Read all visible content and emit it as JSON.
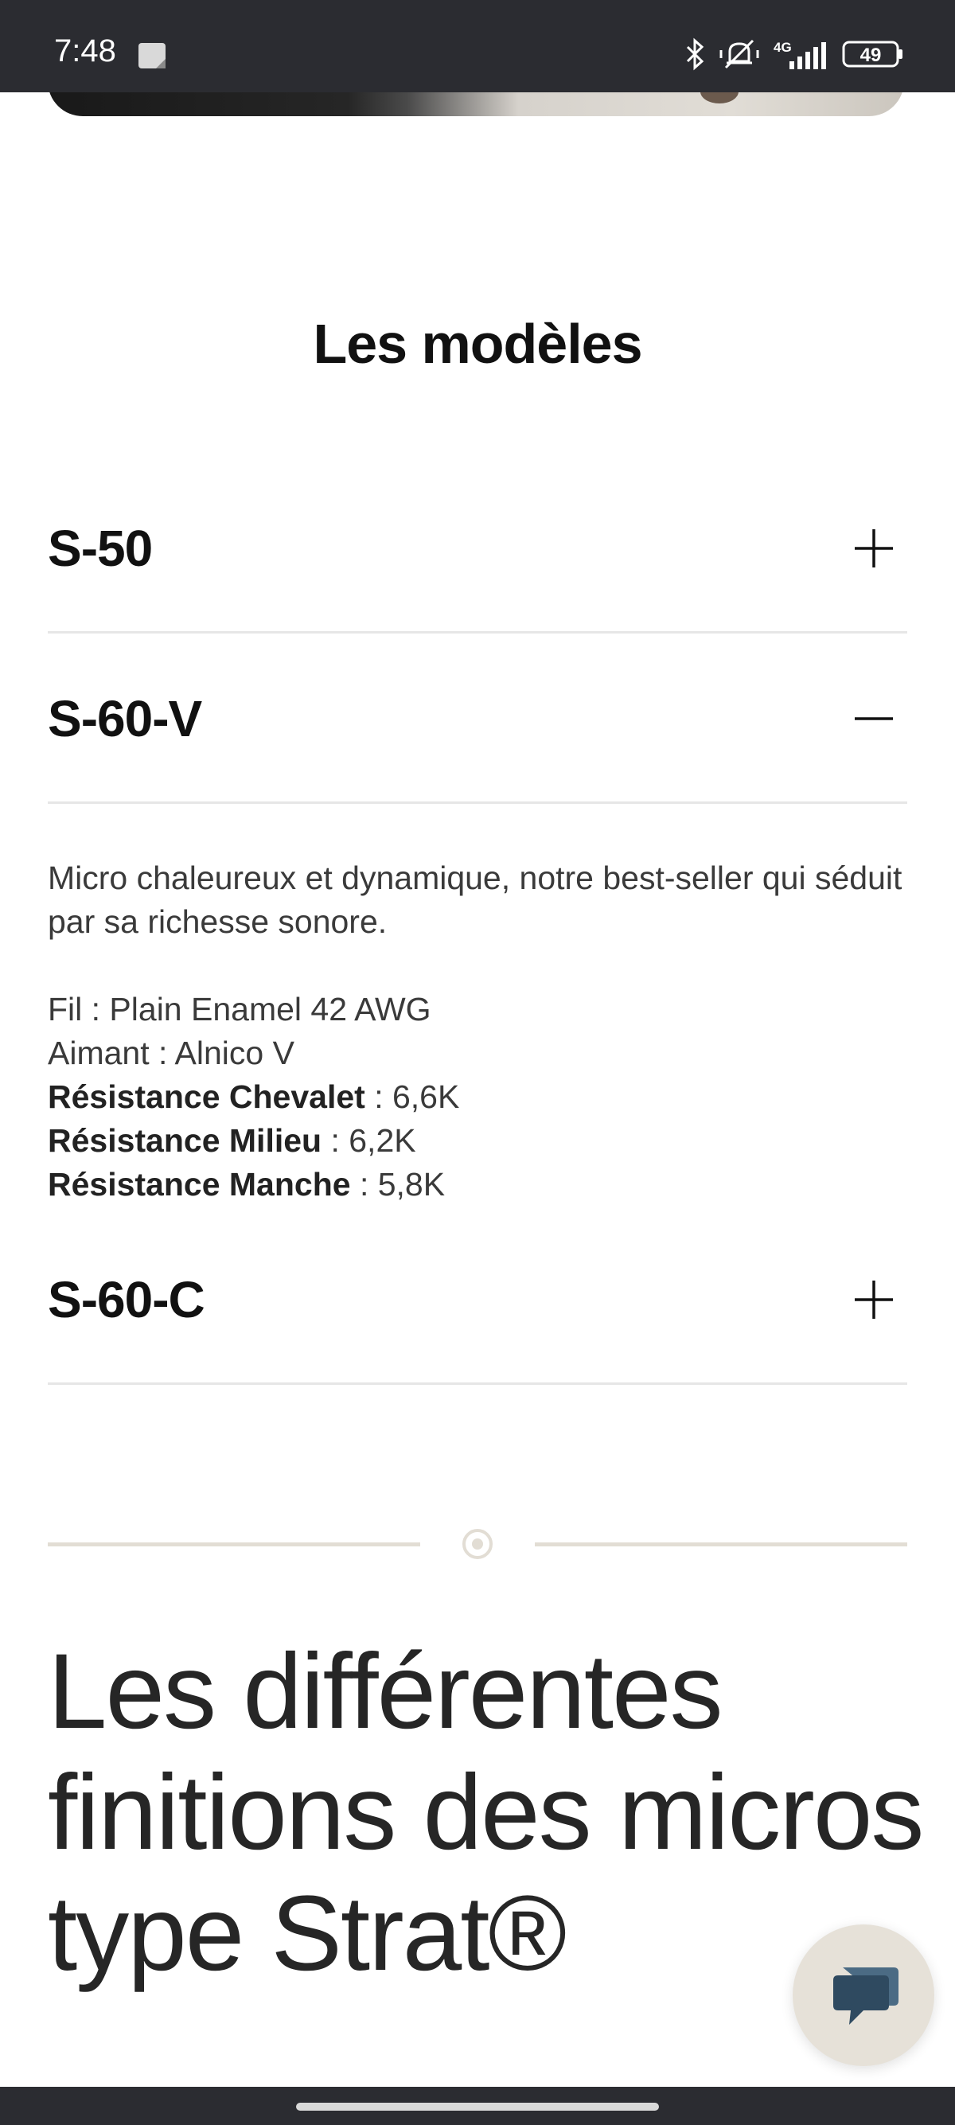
{
  "status_bar": {
    "time": "7:48",
    "icons": [
      "note-icon",
      "bluetooth-icon",
      "mute-icon",
      "signal-4g-icon",
      "battery-icon"
    ],
    "network": "4G",
    "battery": "49"
  },
  "section": {
    "title": "Les modèles"
  },
  "accordion": {
    "items": [
      {
        "title": "S-50",
        "state": "collapsed",
        "icon": "plus-icon"
      },
      {
        "title": "S-60-V",
        "state": "expanded",
        "icon": "minus-icon"
      },
      {
        "title": "S-60-C",
        "state": "collapsed",
        "icon": "plus-icon"
      }
    ],
    "expanded_body": {
      "description": "Micro chaleureux et dynamique, notre best-seller qui séduit par sa richesse sonore.",
      "wire": "Fil : Plain Enamel 42 AWG",
      "magnet": "Aimant : Alnico V",
      "specs": [
        {
          "label": "Résistance Chevalet",
          "value": " : 6,6K"
        },
        {
          "label": "Résistance Milieu",
          "value": " : 6,2K"
        },
        {
          "label": "Résistance Manche",
          "value": " : 5,8K"
        }
      ]
    }
  },
  "divider": {
    "icon": "target-dot-icon"
  },
  "heading": {
    "text": "Les différentes finitions des micros type Strat®"
  },
  "chat": {
    "icon": "chat-bubble-icon"
  },
  "colors": {
    "status_bar_bg": "#2b2c31",
    "text_dark": "#111111",
    "divider_line": "#e2ddd4",
    "chat_button_bg": "#e6e1d8",
    "chat_icon": "#2f4a60"
  }
}
